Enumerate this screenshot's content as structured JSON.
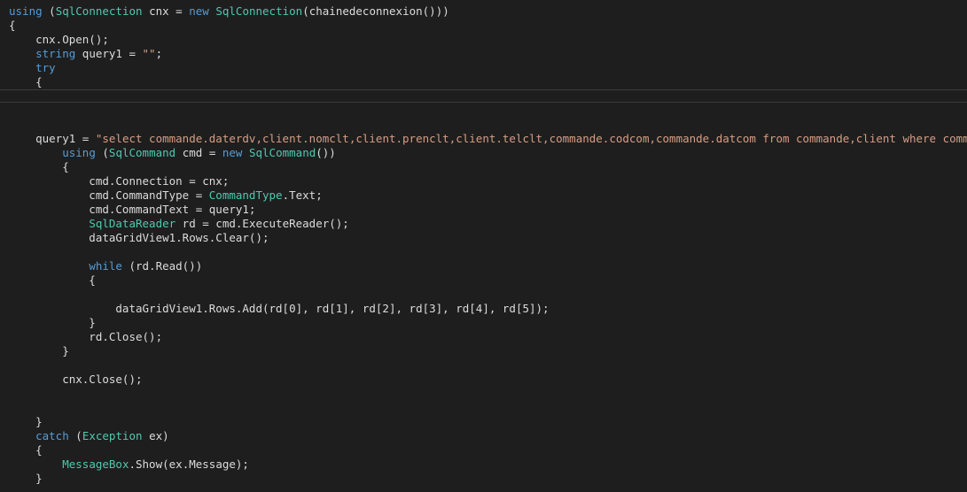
{
  "editor": {
    "lines": [
      [
        {
          "t": "using",
          "c": "kw"
        },
        {
          "t": " ("
        },
        {
          "t": "SqlConnection",
          "c": "type"
        },
        {
          "t": " cnx = "
        },
        {
          "t": "new",
          "c": "kw"
        },
        {
          "t": " "
        },
        {
          "t": "SqlConnection",
          "c": "type"
        },
        {
          "t": "(chainedeconnexion()))"
        }
      ],
      [
        {
          "t": "{"
        }
      ],
      [
        {
          "t": "    cnx.Open();"
        }
      ],
      [
        {
          "t": "    "
        },
        {
          "t": "string",
          "c": "kw"
        },
        {
          "t": " query1 = "
        },
        {
          "t": "\"\"",
          "c": "str"
        },
        {
          "t": ";"
        }
      ],
      [
        {
          "t": "    "
        },
        {
          "t": "try",
          "c": "kw"
        }
      ],
      [
        {
          "t": "    {"
        }
      ],
      [
        {
          "t": ""
        }
      ],
      [
        {
          "t": ""
        }
      ],
      [
        {
          "t": ""
        }
      ],
      [
        {
          "t": "    query1 = "
        },
        {
          "t": "\"select commande.daterdv,client.nomclt,client.prenclt,client.telclt,commande.codcom,commande.datcom from commande,client where commande.codclt",
          "c": "str"
        }
      ],
      [
        {
          "t": "        "
        },
        {
          "t": "using",
          "c": "kw"
        },
        {
          "t": " ("
        },
        {
          "t": "SqlCommand",
          "c": "type"
        },
        {
          "t": " cmd = "
        },
        {
          "t": "new",
          "c": "kw"
        },
        {
          "t": " "
        },
        {
          "t": "SqlCommand",
          "c": "type"
        },
        {
          "t": "())"
        }
      ],
      [
        {
          "t": "        {"
        }
      ],
      [
        {
          "t": "            cmd.Connection = cnx;"
        }
      ],
      [
        {
          "t": "            cmd.CommandType = "
        },
        {
          "t": "CommandType",
          "c": "type"
        },
        {
          "t": ".Text;"
        }
      ],
      [
        {
          "t": "            cmd.CommandText = query1;"
        }
      ],
      [
        {
          "t": "            "
        },
        {
          "t": "SqlDataReader",
          "c": "type"
        },
        {
          "t": " rd = cmd.ExecuteReader();"
        }
      ],
      [
        {
          "t": "            dataGridView1.Rows.Clear();"
        }
      ],
      [
        {
          "t": ""
        }
      ],
      [
        {
          "t": "            "
        },
        {
          "t": "while",
          "c": "kw"
        },
        {
          "t": " (rd.Read())"
        }
      ],
      [
        {
          "t": "            {"
        }
      ],
      [
        {
          "t": ""
        }
      ],
      [
        {
          "t": "                dataGridView1.Rows.Add(rd[0], rd[1], rd[2], rd[3], rd[4], rd[5]);"
        }
      ],
      [
        {
          "t": "            }"
        }
      ],
      [
        {
          "t": "            rd.Close();"
        }
      ],
      [
        {
          "t": "        }"
        }
      ],
      [
        {
          "t": ""
        }
      ],
      [
        {
          "t": "        cnx.Close();"
        }
      ],
      [
        {
          "t": ""
        }
      ],
      [
        {
          "t": ""
        }
      ],
      [
        {
          "t": "    }"
        }
      ],
      [
        {
          "t": "    "
        },
        {
          "t": "catch",
          "c": "kw"
        },
        {
          "t": " ("
        },
        {
          "t": "Exception",
          "c": "type"
        },
        {
          "t": " ex)"
        }
      ],
      [
        {
          "t": "    {"
        }
      ],
      [
        {
          "t": "        "
        },
        {
          "t": "MessageBox",
          "c": "type"
        },
        {
          "t": ".Show(ex.Message);"
        }
      ],
      [
        {
          "t": "    }"
        }
      ]
    ]
  }
}
